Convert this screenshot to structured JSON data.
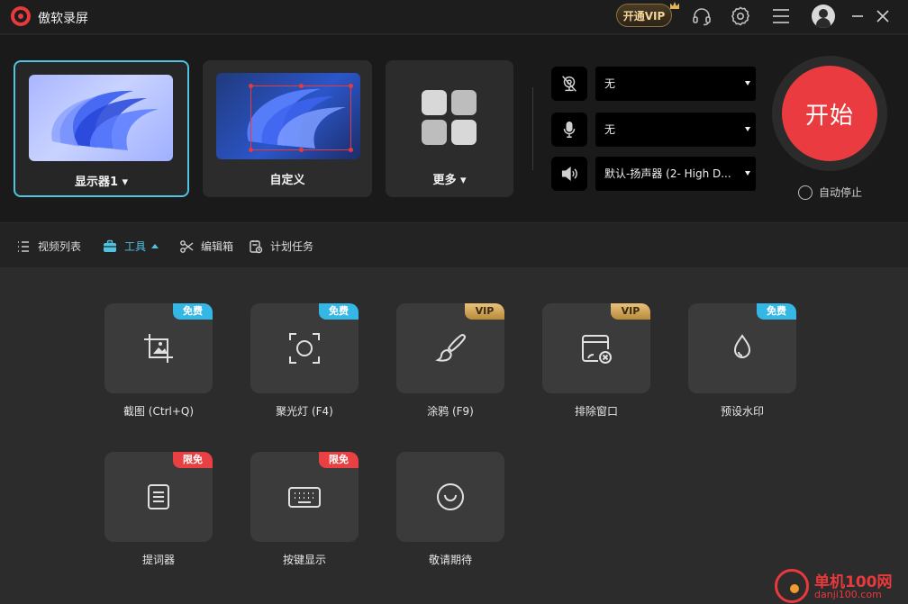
{
  "app": {
    "title": "傲软录屏"
  },
  "titlebar": {
    "vip_label": "开通VIP",
    "icons": [
      "headset-icon",
      "gear-icon",
      "menu-icon",
      "avatar-icon",
      "minimize-icon",
      "close-icon"
    ]
  },
  "capture": {
    "modes": [
      {
        "label": "显示器1 ▾",
        "active": true
      },
      {
        "label": "自定义",
        "active": false
      },
      {
        "label": "更多 ▾",
        "active": false
      }
    ],
    "devices": [
      {
        "icon": "camera-off-icon",
        "value": "无"
      },
      {
        "icon": "microphone-icon",
        "value": "无"
      },
      {
        "icon": "speaker-icon",
        "value": "默认-扬声器 (2- High D..."
      }
    ],
    "start_label": "开始",
    "auto_stop_label": "自动停止"
  },
  "tabs": [
    {
      "label": "视频列表",
      "icon": "list-icon",
      "active": false
    },
    {
      "label": "工具",
      "icon": "toolbox-icon",
      "active": true
    },
    {
      "label": "编辑箱",
      "icon": "scissors-icon",
      "active": false
    },
    {
      "label": "计划任务",
      "icon": "schedule-icon",
      "active": false
    }
  ],
  "tools": [
    {
      "label": "截图 (Ctrl+Q)",
      "badge": "免费",
      "badge_type": "free",
      "icon": "screenshot-icon"
    },
    {
      "label": "聚光灯 (F4)",
      "badge": "免费",
      "badge_type": "free",
      "icon": "spotlight-icon"
    },
    {
      "label": "涂鸦 (F9)",
      "badge": "VIP",
      "badge_type": "vip",
      "icon": "brush-icon"
    },
    {
      "label": "排除窗口",
      "badge": "VIP",
      "badge_type": "vip",
      "icon": "exclude-window-icon"
    },
    {
      "label": "预设水印",
      "badge": "免费",
      "badge_type": "free",
      "icon": "watermark-drop-icon"
    },
    {
      "label": "提词器",
      "badge": "限免",
      "badge_type": "limit",
      "icon": "teleprompter-icon"
    },
    {
      "label": "按键显示",
      "badge": "限免",
      "badge_type": "limit",
      "icon": "keyboard-icon"
    },
    {
      "label": "敬请期待",
      "badge": "",
      "badge_type": "",
      "icon": "coming-soon-icon"
    }
  ],
  "watermark": {
    "line1": "单机100网",
    "line2": "danji100.com"
  },
  "colors": {
    "accent": "#4fc3e0",
    "start": "#ea3c40",
    "free_badge": "#35b7e6",
    "limit_badge": "#e94043",
    "vip_gold": "#e8c27a"
  }
}
